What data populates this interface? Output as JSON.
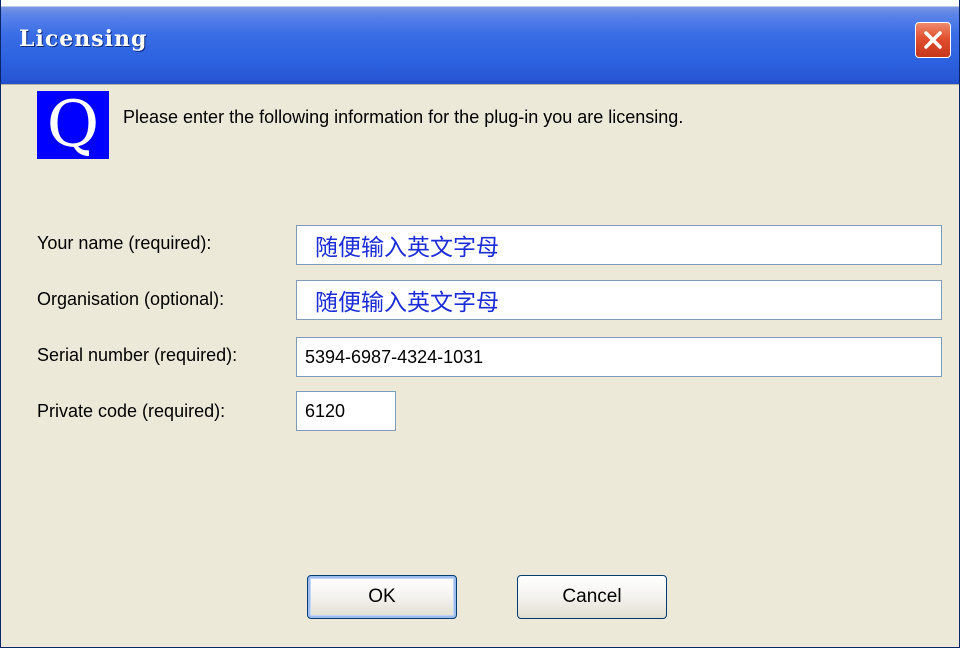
{
  "window": {
    "title": "Licensing",
    "close_label": "Close"
  },
  "intro": {
    "icon_letter": "Q",
    "text": "Please enter the following information for the plug-in you are licensing."
  },
  "form": {
    "name_label": "Your name (required):",
    "name_value": "随便输入英文字母",
    "org_label": "Organisation (optional):",
    "org_value": "随便输入英文字母",
    "serial_label": "Serial number (required):",
    "serial_value": "5394-6987-4324-1031",
    "code_label": "Private code (required):",
    "code_value": "6120"
  },
  "buttons": {
    "ok": "OK",
    "cancel": "Cancel"
  },
  "colors": {
    "titlebar": "#2d62e0",
    "dialog_bg": "#ece9d8",
    "icon_bg": "#0000ff",
    "annotation_text": "#1c2cd6",
    "close_button": "#e0502f"
  }
}
